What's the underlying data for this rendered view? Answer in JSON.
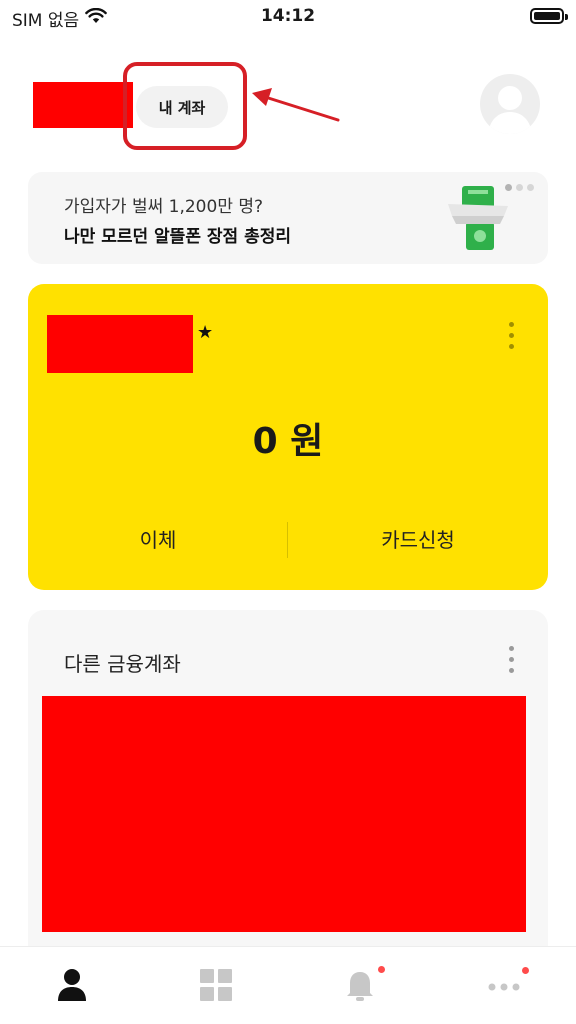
{
  "status_bar": {
    "carrier": "SIM 없음",
    "time": "14:12",
    "icons": [
      "wifi-icon",
      "battery-icon"
    ]
  },
  "header": {
    "my_account_label": "내 계좌",
    "avatar_icon": "person-avatar-icon"
  },
  "banner": {
    "line1": "가입자가 벌써 1,200만 명?",
    "line2": "나만 모르던 알뜰폰 장점 총정리",
    "page_dots": 3,
    "active_dot": 1
  },
  "main_account": {
    "favorite_icon": "star-icon",
    "balance": "0 원",
    "actions": {
      "transfer": "이체",
      "card_apply": "카드신청"
    }
  },
  "other_accounts": {
    "title": "다른 금융계좌"
  },
  "tab_bar": {
    "tabs": [
      "person-icon",
      "grid-icon",
      "bell-icon",
      "more-icon"
    ],
    "active_tab": "person-icon"
  },
  "colors": {
    "accent_yellow": "#ffe100",
    "annotation_red": "#d61f26",
    "redaction_red": "#ff0000",
    "notification_dot": "#ff4b4b"
  }
}
